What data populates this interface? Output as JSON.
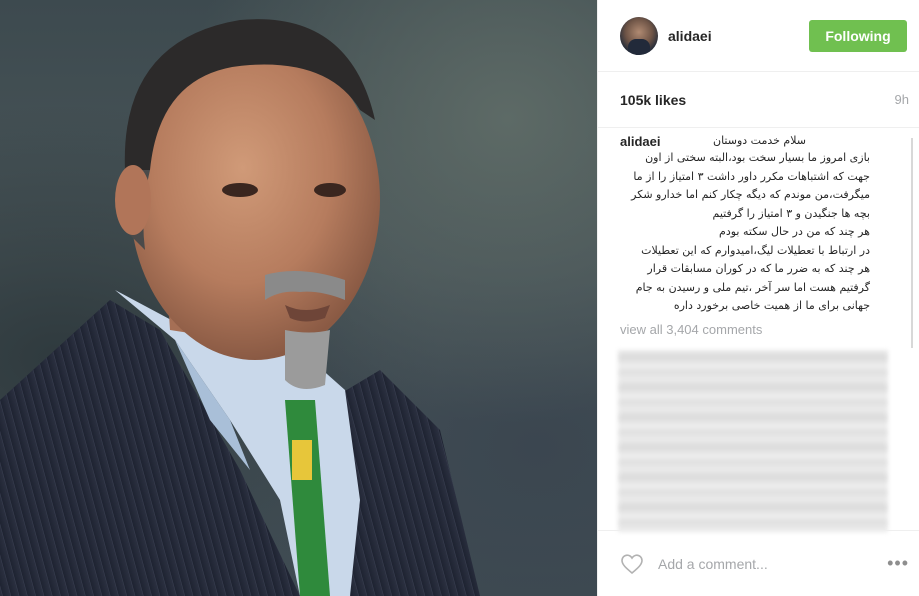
{
  "post": {
    "username": "alidaei",
    "follow_label": "Following",
    "likes": "105k likes",
    "time": "9h",
    "caption_user": "alidaei",
    "caption_first_line": "سلام خدمت دوستان",
    "caption_lines": [
      "بازی امروز ما بسیار سخت بود،البته سختی از اون",
      "جهت که اشتباهات مکرر داور داشت ۳ امتیاز را از ما",
      "میگرفت،من موندم که دیگه چکار کنم اما خدارو شکر",
      "بچه ها جنگیدن و ۳ امتیاز را گرفتیم",
      "هر چند که من در حال سکته بودم",
      "در ارتباط با تعطیلات لیگ،امیدوارم که این تعطیلات",
      "هر چند که به ضرر ما که در کوران مسابقات قرار",
      "گرفتیم هست اما سر آخر ،تیم ملی و رسیدن به جام",
      "جهانی برای ما از همیت خاصی برخورد داره"
    ],
    "view_all": "view all 3,404 comments",
    "comment_placeholder": "Add a comment...",
    "more_label": "•••"
  },
  "colors": {
    "follow_bg": "#70c050",
    "muted": "#a5a7aa"
  },
  "icons": {
    "like": "heart-icon",
    "more": "more-options-icon"
  }
}
